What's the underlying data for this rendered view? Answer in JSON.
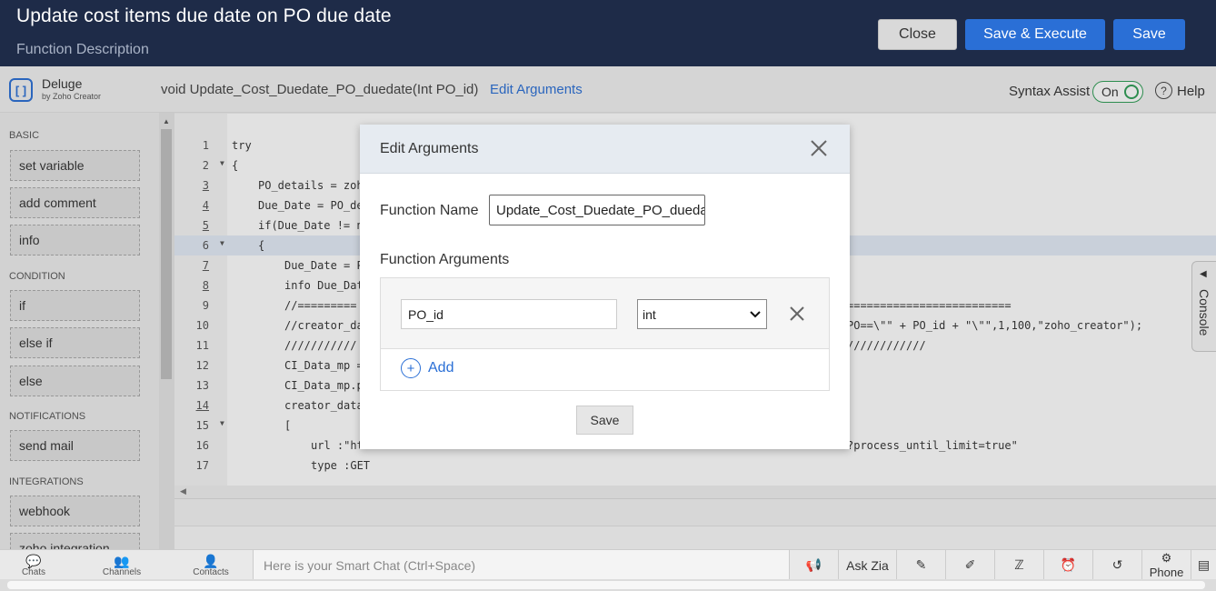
{
  "header": {
    "title": "Update cost items due date on PO due date",
    "description": "Function Description",
    "close_label": "Close",
    "save_execute_label": "Save & Execute",
    "save_label": "Save"
  },
  "toolbar": {
    "logo_name": "Deluge",
    "logo_sub": "by Zoho Creator",
    "signature": "void  Update_Cost_Duedate_PO_duedate(Int PO_id)",
    "edit_arguments_label": "Edit Arguments",
    "syntax_assist_label": "Syntax Assist",
    "toggle_label": "On",
    "help_label": "Help"
  },
  "sidebar": {
    "categories": [
      {
        "name": "BASIC",
        "items": [
          "set variable",
          "add comment",
          "info"
        ]
      },
      {
        "name": "CONDITION",
        "items": [
          "if",
          "else if",
          "else"
        ]
      },
      {
        "name": "NOTIFICATIONS",
        "items": [
          "send mail"
        ]
      },
      {
        "name": "INTEGRATIONS",
        "items": [
          "webhook",
          "zoho integration"
        ]
      }
    ]
  },
  "editor": {
    "lines": [
      {
        "n": "1",
        "text": "try"
      },
      {
        "n": "2",
        "text": "{"
      },
      {
        "n": "3",
        "text": "PO_details = zoh"
      },
      {
        "n": "4",
        "text": "Due_Date = PO_de"
      },
      {
        "n": "5",
        "text": "if(Due_Date != n"
      },
      {
        "n": "6",
        "text": "{"
      },
      {
        "n": "7",
        "text": "Due_Date = P"
      },
      {
        "n": "8",
        "text": "info Due_Dat"
      },
      {
        "n": "9",
        "text": "//=========",
        "tail": "========================="
      },
      {
        "n": "10",
        "text": "//creator_da",
        "tail": "PO==\\\"\" + PO_id + \"\\\"\",1,100,\"zoho_creator\");"
      },
      {
        "n": "11",
        "text": "///////////",
        "tail": "////////////"
      },
      {
        "n": "12",
        "text": "CI_Data_mp ="
      },
      {
        "n": "13",
        "text": "CI_Data_mp.p"
      },
      {
        "n": "14",
        "text": "creator_data"
      },
      {
        "n": "15",
        "text": "["
      },
      {
        "n": "16",
        "text": "url :\"ht",
        "tail": "?process_until_limit=true\""
      },
      {
        "n": "17",
        "text": "type :GET"
      }
    ]
  },
  "console_label": "Console",
  "modal": {
    "title": "Edit Arguments",
    "function_name_label": "Function Name",
    "function_name_value": "Update_Cost_Duedate_PO_duedate",
    "function_arguments_label": "Function Arguments",
    "arguments": [
      {
        "name": "PO_id",
        "type": "int"
      }
    ],
    "add_label": "Add",
    "save_label": "Save"
  },
  "bottombar": {
    "tabs": [
      "Chats",
      "Channels",
      "Contacts"
    ],
    "smartchat_placeholder": "Here is your Smart Chat (Ctrl+Space)",
    "ask_zia_label": "Ask Zia",
    "phone_label": "Phone"
  }
}
